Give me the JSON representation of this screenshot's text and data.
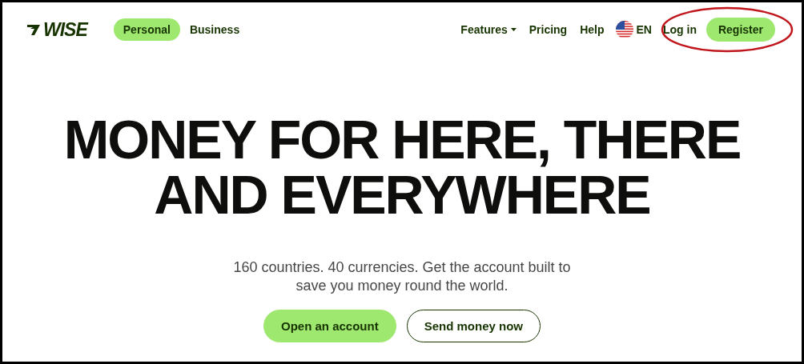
{
  "logo": "WISE",
  "segments": [
    {
      "label": "Personal",
      "selected": true
    },
    {
      "label": "Business",
      "selected": false
    }
  ],
  "nav": [
    {
      "label": "Features",
      "kind": "dropdown"
    },
    {
      "label": "Pricing",
      "kind": "link"
    },
    {
      "label": "Help",
      "kind": "link"
    }
  ],
  "language": "EN",
  "login": "Log in",
  "register": "Register",
  "headline": [
    "MONEY FOR HERE, THERE",
    "AND EVERYWHERE"
  ],
  "subtitle": "160 countries. 40 currencies. Get the account built to save you money round the world.",
  "actions": [
    {
      "label": "Open an account",
      "kind": "primary"
    },
    {
      "label": "Send money now",
      "kind": "secondary"
    }
  ]
}
